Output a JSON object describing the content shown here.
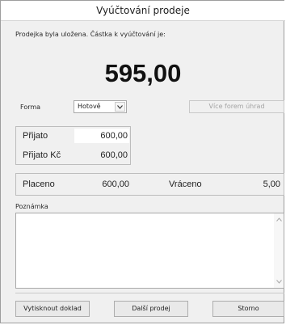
{
  "window": {
    "title": "Vyúčtování prodeje"
  },
  "header": {
    "message": "Prodejka byla uložena. Částka k vyúčtování je:",
    "amount": "595,00"
  },
  "payment": {
    "forma_label": "Forma",
    "forma_value": "Hotově",
    "vice_forem_label": "Více forem úhrad"
  },
  "received": {
    "prijato_label": "Přijato",
    "prijato_value": "600,00",
    "prijato_kc_label": "Přijato Kč",
    "prijato_kc_value": "600,00"
  },
  "summary": {
    "placeno_label": "Placeno",
    "placeno_value": "600,00",
    "vraceno_label": "Vráceno",
    "vraceno_value": "5,00"
  },
  "note": {
    "label": "Poznámka",
    "value": ""
  },
  "buttons": {
    "print": "Vytisknout doklad",
    "next": "Další prodej",
    "cancel": "Storno"
  }
}
